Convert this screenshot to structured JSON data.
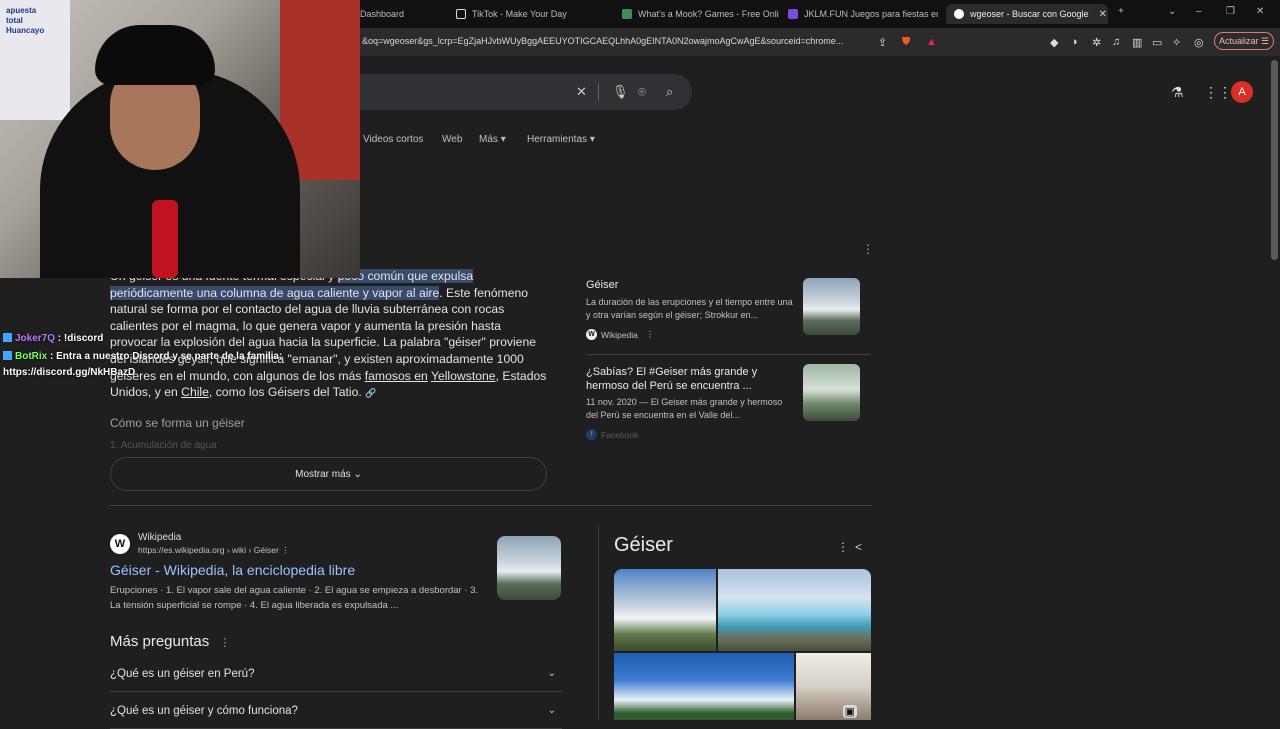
{
  "browser": {
    "tabs": [
      {
        "label": "Dashboard"
      },
      {
        "label": "TikTok - Make Your Day"
      },
      {
        "label": "What's a Mook? Games - Free Onli"
      },
      {
        "label": "JKLM.FUN Juegos para fiestas en P"
      },
      {
        "label": "wgeoser - Buscar con Google",
        "active": true
      }
    ],
    "url": "&oq=wgeoser&gs_lcrp=EgZjaHJvbWUyBggAEEUYOTIGCAEQLhhA0gEINTA0N2owajmoAgCwAgE&sourceid=chrome...",
    "update_label": "Actualizar"
  },
  "header": {
    "avatar_letter": "A"
  },
  "nav_tabs": [
    "Videos cortos",
    "Web",
    "Más",
    "Herramientas"
  ],
  "snippet": {
    "hidden_lead": "Un géiser es una fuente termal especial y",
    "highlight_1": "poco común que expulsa",
    "highlight_2": "periódicamente una columna de agua caliente y vapor al aire",
    "text_1": ". Este fenómeno natural se forma por el contacto del agua de lluvia subterránea con rocas calientes por el magma, lo que genera vapor y aumenta la presión hasta provocar la explosión del agua hacia la superficie. La palabra \"géiser\" proviene del islandés geysir, que significa \"emanar\", y existen aproximadamente 1000 géiseres en el mundo, con algunos de los más ",
    "link_famosos": "famosos en",
    "link_yellowstone": "Yellowstone",
    "text_2": ", Estados Unidos, y en ",
    "link_chile": "Chile",
    "text_3": ", como los Géisers del Tatio.",
    "how_forms": "Cómo se forma un géiser",
    "faded_line": "1. Acumulación de agua",
    "show_more": "Mostrar más"
  },
  "side_cards": [
    {
      "title": "Géiser",
      "text": "La duración de las erupciones y el tiempo entre una y otra varían según el géiser; Strokkur en...",
      "source": "Wikipedia",
      "badge": "W"
    },
    {
      "title": "¿Sabías? El #Geiser más grande y hermoso del Perú se encuentra ...",
      "text": "11 nov. 2020 — El Geiser más grande y hermoso del Perú se encuentra en el Valle del...",
      "source": "Facebook",
      "badge": "f"
    }
  ],
  "chat": [
    {
      "user": "Joker7Q",
      "message": " : !discord",
      "color": "#b57cff"
    },
    {
      "user": "BotRix",
      "message": " : Entra a nuestro Discord y se parte de la familia:",
      "color": "#7dff5a"
    },
    {
      "user": "",
      "message": "https://discord.gg/NkHBazD",
      "color": "#ffffff"
    }
  ],
  "result": {
    "logo": "W",
    "site": "Wikipedia",
    "url": "https://es.wikipedia.org › wiki › Géiser",
    "title": "Géiser - Wikipedia, la enciclopedia libre",
    "desc": "Erupciones · 1. El vapor sale del agua caliente · 2. El agua se empieza a desbordar · 3. La tensión superficial se rompe · 4. El agua liberada es expulsada ..."
  },
  "more_questions": {
    "heading": "Más preguntas",
    "items": [
      "¿Qué es un géiser en Perú?",
      "¿Qué es un géiser y cómo funciona?"
    ]
  },
  "knowledge_panel": {
    "title": "Géiser"
  },
  "webcam_text": {
    "sign_top": "apuesta",
    "sign_mid": "total",
    "sign_bot": "Huancayo"
  }
}
